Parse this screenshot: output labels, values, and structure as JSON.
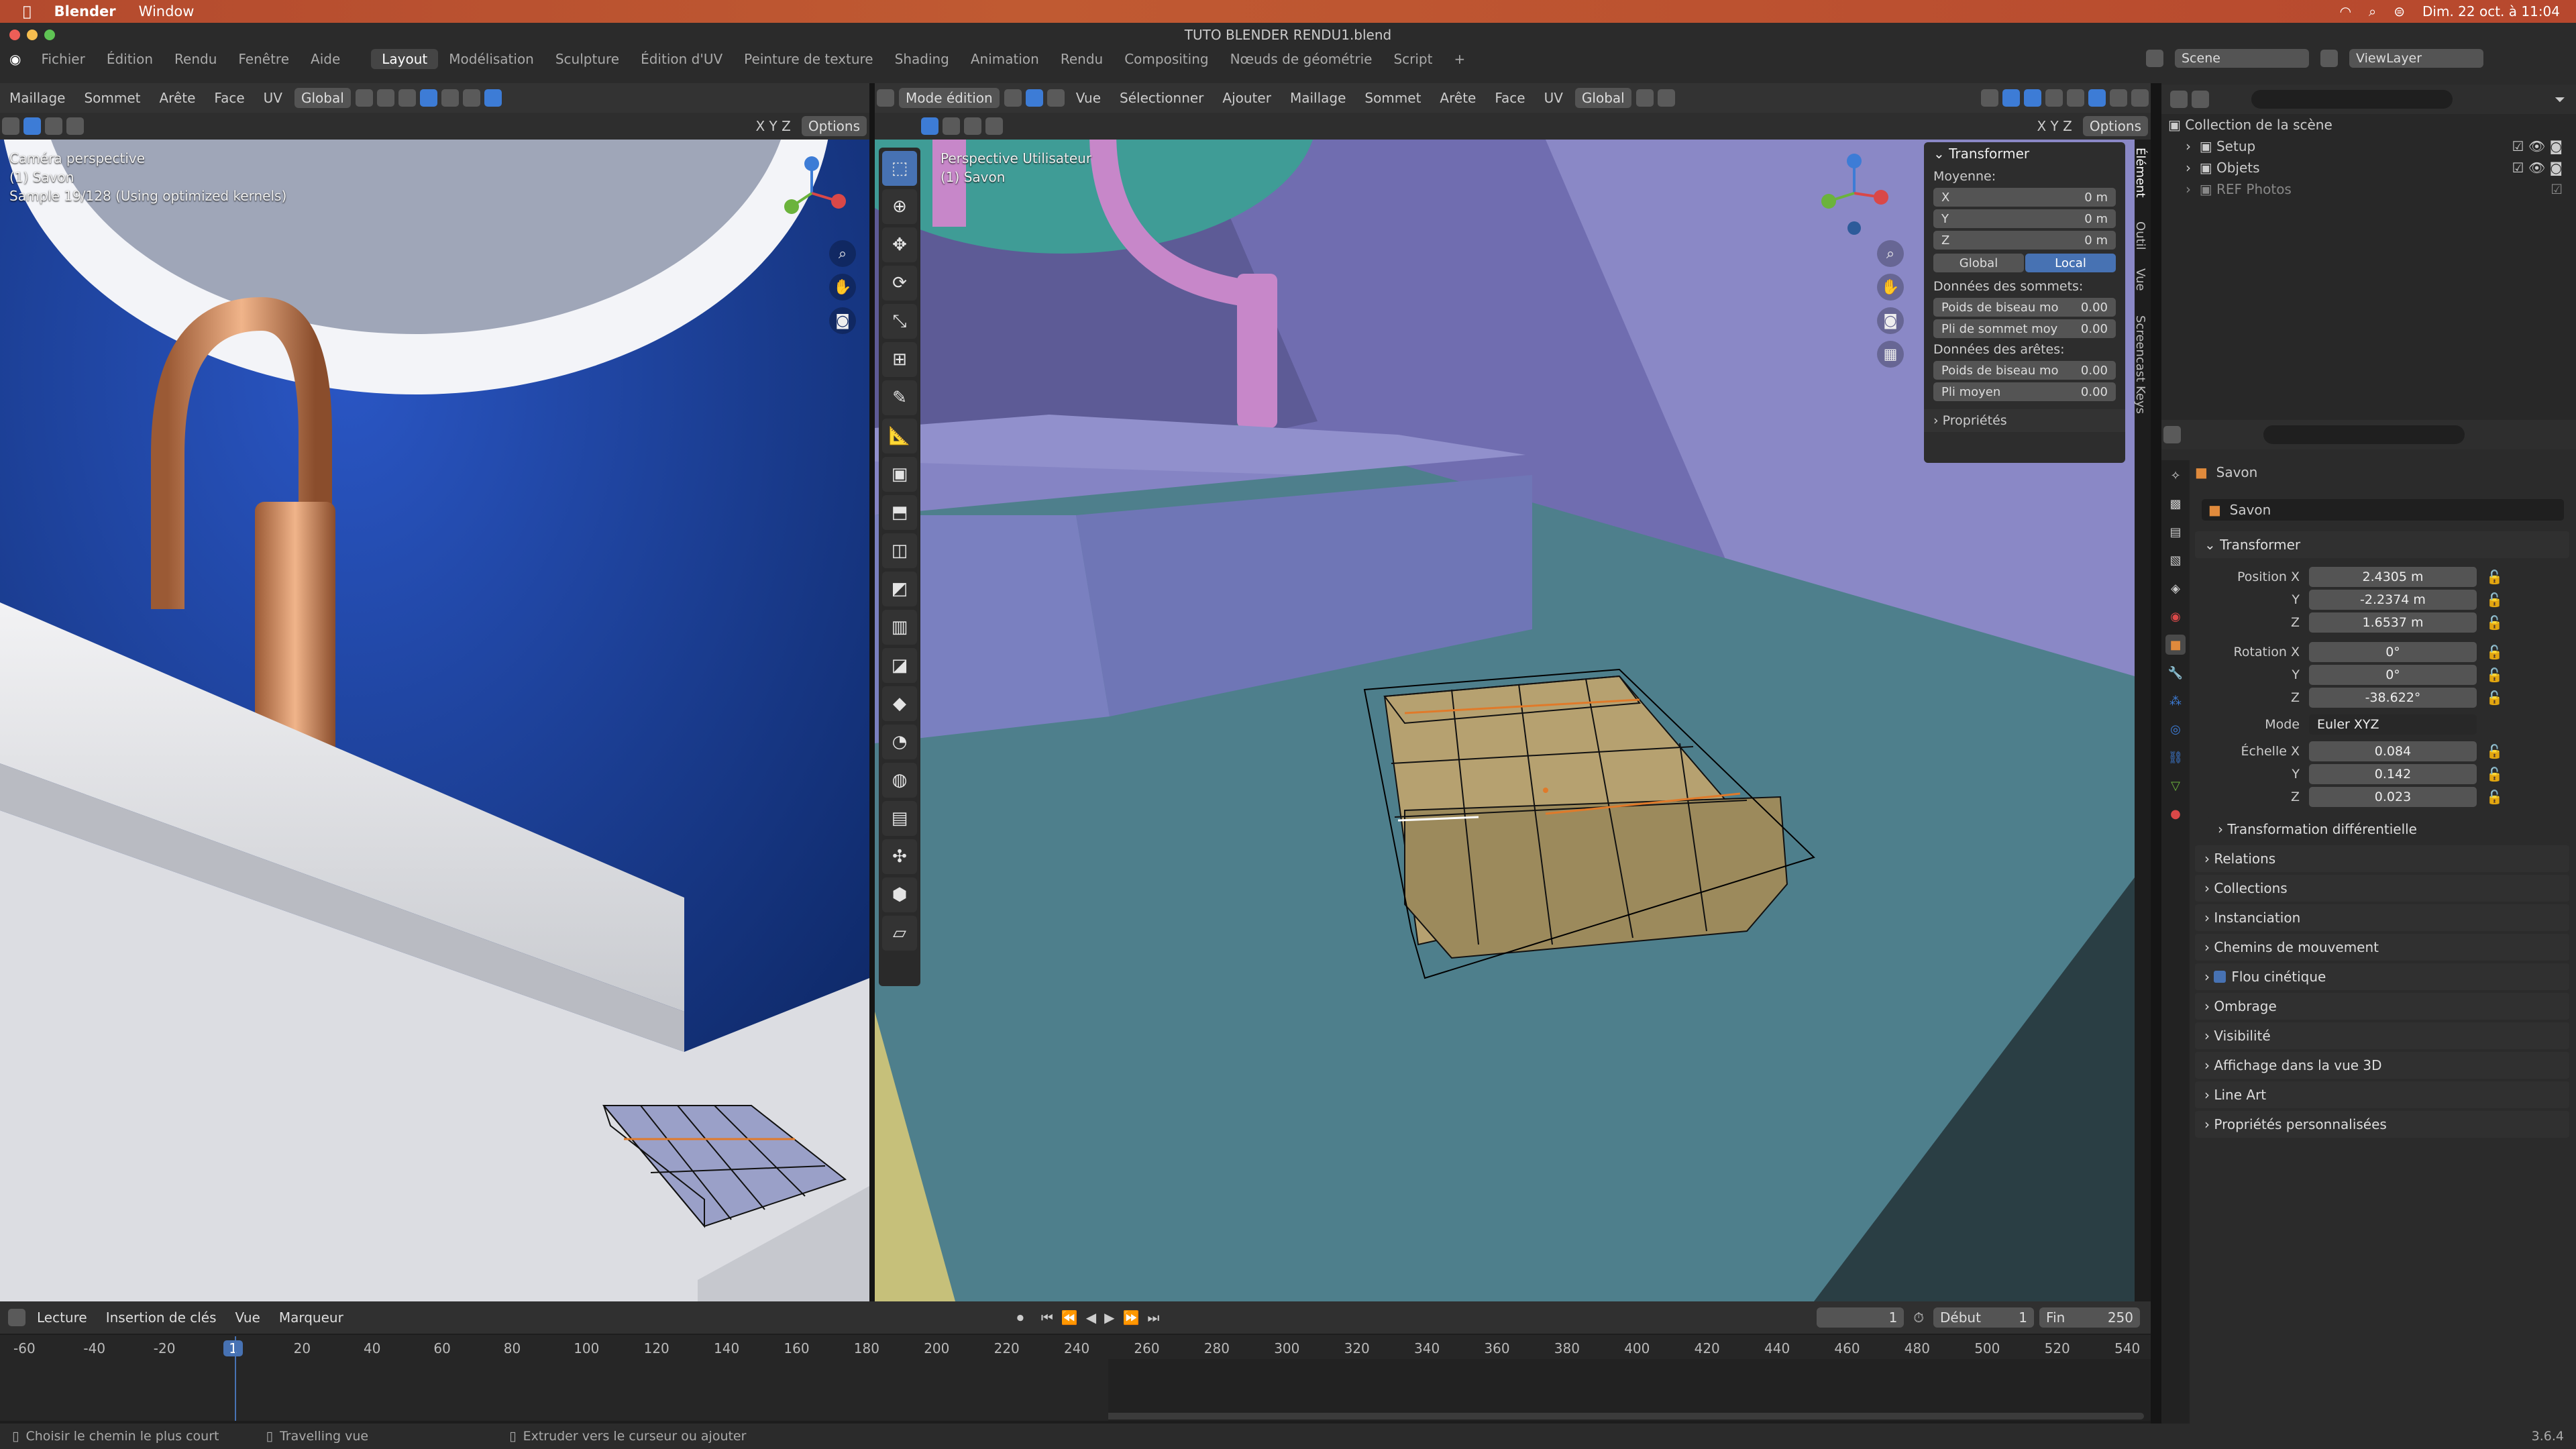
{
  "mac_menubar": {
    "app": "Blender",
    "window": "Window",
    "datetime": "Dim. 22 oct. à 11:04"
  },
  "window_title": "TUTO BLENDER RENDU1.blend",
  "menus": [
    "Fichier",
    "Édition",
    "Rendu",
    "Fenêtre",
    "Aide"
  ],
  "workspace_tabs": [
    "Layout",
    "Modélisation",
    "Sculpture",
    "Édition d'UV",
    "Peinture de texture",
    "Shading",
    "Animation",
    "Rendu",
    "Compositing",
    "Nœuds de géométrie",
    "Script"
  ],
  "active_workspace": "Layout",
  "scene": "Scene",
  "view_layer": "ViewLayer",
  "left_header": {
    "menus": [
      "Maillage",
      "Sommet",
      "Arête",
      "Face",
      "UV"
    ],
    "orientation": "Global",
    "options": "Options",
    "axes": "X Y Z"
  },
  "left_viewport": {
    "line1": "Caméra perspective",
    "line2": "(1) Savon",
    "line3": "Sample 19/128 (Using optimized kernels)"
  },
  "right_header": {
    "mode": "Mode édition",
    "menus": [
      "Vue",
      "Sélectionner",
      "Ajouter",
      "Maillage",
      "Sommet",
      "Arête",
      "Face",
      "UV"
    ],
    "orientation": "Global",
    "options": "Options",
    "axes": "X Y Z"
  },
  "right_viewport": {
    "line1": "Perspective Utilisateur",
    "line2": "(1) Savon"
  },
  "n_panel": {
    "title": "Transformer",
    "median": "Moyenne:",
    "x_label": "X",
    "x": "0 m",
    "y_label": "Y",
    "y": "0 m",
    "z_label": "Z",
    "z": "0 m",
    "global": "Global",
    "local": "Local",
    "vertex_data": "Données des sommets:",
    "vbevel_label": "Poids de biseau mo",
    "vbevel": "0.00",
    "vcrease_label": "Pli de sommet moy",
    "vcrease": "0.00",
    "edge_data": "Données des arêtes:",
    "ebevel_label": "Poids de biseau mo",
    "ebevel": "0.00",
    "ecrease_label": "Pli moyen",
    "ecrease": "0.00",
    "properties": "Propriétés"
  },
  "side_tabs": [
    "Élément",
    "Outil",
    "Vue",
    "Screencast Keys"
  ],
  "outliner": {
    "root": "Collection de la scène",
    "items": [
      "Setup",
      "Objets",
      "REF Photos"
    ]
  },
  "properties": {
    "object": "Savon",
    "mesh": "Savon",
    "transform": "Transformer",
    "position_label": "Position X",
    "pos_x": "2.4305 m",
    "pos_y": "-2.2374 m",
    "pos_z": "1.6537 m",
    "rotation_label": "Rotation X",
    "rot_x": "0°",
    "rot_y": "0°",
    "rot_z": "-38.622°",
    "mode_label": "Mode",
    "mode": "Euler XYZ",
    "scale_label": "Échelle X",
    "sc_x": "0.084",
    "sc_y": "0.142",
    "sc_z": "0.023",
    "y": "Y",
    "z": "Z",
    "delta": "Transformation différentielle",
    "sections": [
      "Relations",
      "Collections",
      "Instanciation",
      "Chemins de mouvement",
      "Flou cinétique",
      "Ombrage",
      "Visibilité",
      "Affichage dans la vue 3D",
      "Line Art",
      "Propriétés personnalisées"
    ]
  },
  "timeline": {
    "menus": [
      "Lecture",
      "Insertion de clés",
      "Vue",
      "Marqueur"
    ],
    "current": "1",
    "start_label": "Début",
    "start": "1",
    "end_label": "Fin",
    "end": "250",
    "ticks": [
      "-60",
      "-40",
      "-20",
      "1",
      "20",
      "40",
      "60",
      "80",
      "100",
      "120",
      "140",
      "160",
      "180",
      "200",
      "220",
      "240",
      "260",
      "280",
      "300",
      "320",
      "340",
      "360",
      "380",
      "400",
      "420",
      "440",
      "460",
      "480",
      "500",
      "520",
      "540"
    ]
  },
  "status": {
    "left": "Choisir le chemin le plus court",
    "middle": "Travelling vue",
    "right": "Extruder vers le curseur ou ajouter",
    "version": "3.6.4"
  }
}
